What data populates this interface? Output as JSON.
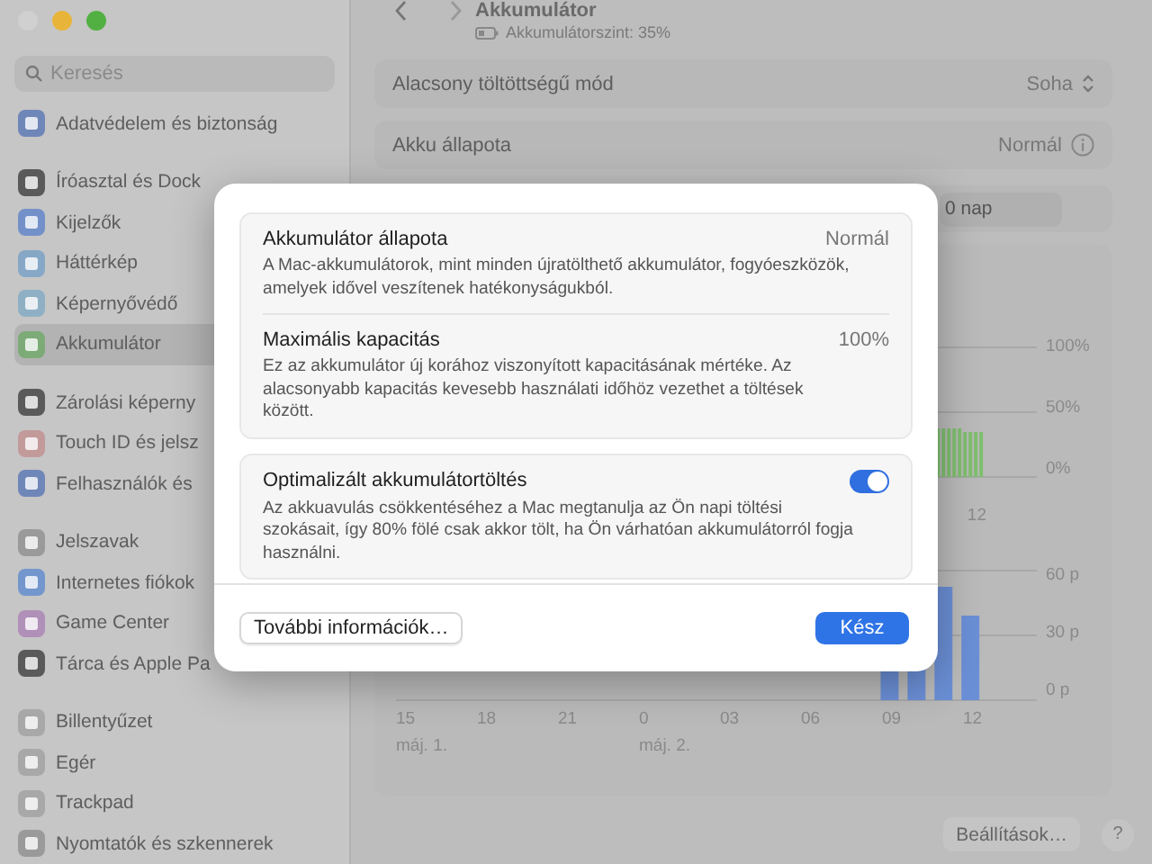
{
  "sidebar": {
    "search": {
      "placeholder": "Keresés"
    },
    "groups": [
      [
        {
          "label": "Adatvédelem és biztonság",
          "color": "#6f86b8",
          "selected": false
        }
      ],
      [
        {
          "label": "Íróasztal és Dock",
          "color": "#5a5a5a",
          "selected": false
        },
        {
          "label": "Kijelzők",
          "color": "#7391c8",
          "selected": false
        },
        {
          "label": "Háttérkép",
          "color": "#86a8c6",
          "selected": false
        },
        {
          "label": "Képernyővédő",
          "color": "#8fb0c4",
          "selected": false
        },
        {
          "label": "Akkumulátor",
          "color": "#7dab78",
          "selected": true
        }
      ],
      [
        {
          "label": "Zárolási képerny",
          "color": "#5a5a5a",
          "selected": false
        },
        {
          "label": "Touch ID és jelsz",
          "color": "#c29a9a",
          "selected": false
        },
        {
          "label": "Felhasználók és",
          "color": "#6f86b8",
          "selected": false
        }
      ],
      [
        {
          "label": "Jelszavak",
          "color": "#9a9a9a",
          "selected": false
        },
        {
          "label": "Internetes fiókok",
          "color": "#7396cc",
          "selected": false
        },
        {
          "label": "Game Center",
          "color": "#b08fb8",
          "selected": false
        },
        {
          "label": "Tárca és Apple Pa",
          "color": "#5a5a5a",
          "selected": false
        }
      ],
      [
        {
          "label": "Billentyűzet",
          "color": "#a8a8a8",
          "selected": false
        },
        {
          "label": "Egér",
          "color": "#a8a8a8",
          "selected": false
        },
        {
          "label": "Trackpad",
          "color": "#a8a8a8",
          "selected": false
        },
        {
          "label": "Nyomtatók és szkennerek",
          "color": "#9a9a9a",
          "selected": false
        }
      ]
    ]
  },
  "header": {
    "title": "Akkumulátor",
    "subtitle": "Akkumulátorszint: 35%"
  },
  "settings_rows": [
    {
      "kind": "popup",
      "label": "Alacsony töltöttségű mód",
      "value": "Soha"
    },
    {
      "kind": "info",
      "label": "Akku állapota",
      "value": "Normál"
    }
  ],
  "range_control": {
    "label": "0 nap"
  },
  "level_chart": {
    "y_labels": [
      "100%",
      "50%",
      "0%"
    ],
    "x_labels": [
      "12"
    ]
  },
  "activity_chart": {
    "y_labels": [
      "60 p",
      "30 p",
      "0 p"
    ],
    "x_labels": [
      "15",
      "18",
      "21",
      "0",
      "03",
      "06",
      "09",
      "12"
    ],
    "date_labels": [
      "máj. 1.",
      "máj. 2."
    ]
  },
  "footer": {
    "settings_button": "Beállítások…",
    "help_button": "?"
  },
  "dialog": {
    "sections": [
      {
        "rows": [
          {
            "title": "Akkumulátor állapota",
            "value": "Normál",
            "description": "A Mac-akkumulátorok, mint minden újratölthető akkumulátor, fogyóeszközök, amelyek idővel veszítenek hatékonyságukból."
          },
          {
            "title": "Maximális kapacitás",
            "value": "100%",
            "description": "Ez az akkumulátor új korához viszonyított kapacitásának mértéke. Az alacsonyabb kapacitás kevesebb használati időhöz vezethet a töltések között."
          }
        ]
      },
      {
        "rows": [
          {
            "title": "Optimalizált akkumulátortöltés",
            "toggle": {
              "on": true
            },
            "description": "Az akkuavulás csökkentéséhez a Mac megtanulja az Ön napi töltési szokásait, így 80% fölé csak akkor tölt, ha Ön várhatóan akkumulátorról fogja használni."
          }
        ]
      }
    ],
    "more_button": "További információk…",
    "done_button": "Kész"
  }
}
